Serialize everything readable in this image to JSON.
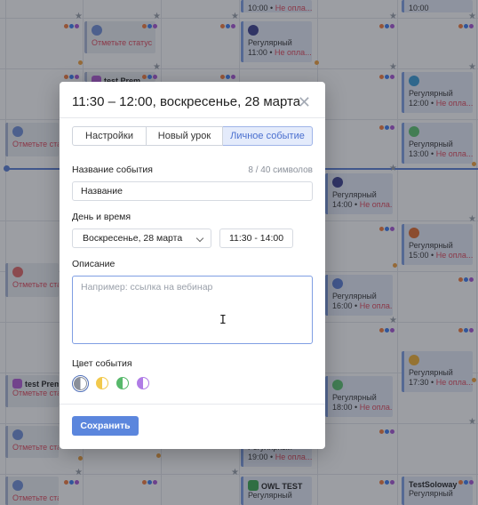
{
  "modal": {
    "title": "11:30 – 12:00, воскресенье, 28 марта",
    "tabs": [
      "Настройки",
      "Новый урок",
      "Личное событие"
    ],
    "active_tab": "Личное событие",
    "event_name_label": "Название события",
    "char_counter": "8 / 40 символов",
    "event_name_value": "Название",
    "datetime_label": "День и время",
    "date_value": "Воскресенье, 28 марта",
    "time_value": "11:30 - 14:00",
    "description_label": "Описание",
    "description_placeholder": "Например: ссылка на вебинар",
    "color_label": "Цвет события",
    "colors": [
      "#8a8f99",
      "#f2c94c",
      "#57b86b",
      "#b07ce6"
    ],
    "save_label": "Сохранить"
  },
  "calendar": {
    "status_text": "Отметьте статус",
    "regular": "Регулярный",
    "unpaid": "Не опла...",
    "sep": "•",
    "test_prem": "test Prem",
    "owl_test": "OWL TEST",
    "test_soloway": "TestSoloway",
    "times": {
      "t1000": "10:00",
      "t1100": "11:00",
      "t1200": "12:00",
      "t1300": "13:00",
      "t1400": "14:00",
      "t1500": "15:00",
      "t1600": "16:00",
      "t1730": "17:30",
      "t1800": "18:00",
      "t1900": "19:00"
    },
    "colors": {
      "accent": "#5b86dd",
      "unpaid": "#e0475b"
    }
  }
}
